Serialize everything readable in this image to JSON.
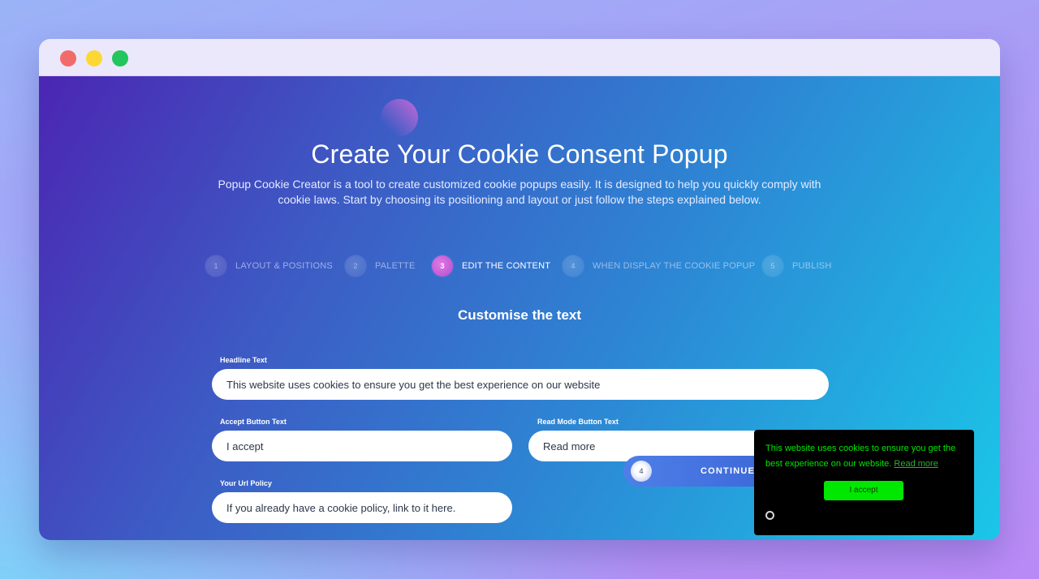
{
  "window": {
    "controls": [
      "close",
      "minimize",
      "maximize"
    ]
  },
  "hero": {
    "title": "Create Your Cookie Consent Popup",
    "subtitle": "Popup Cookie Creator is a tool to create customized cookie popups easily. It is designed to help you quickly comply with cookie laws. Start by choosing its positioning and layout or just follow the steps explained below."
  },
  "steps": [
    {
      "num": "1",
      "label": "LAYOUT & POSITIONS",
      "active": false
    },
    {
      "num": "2",
      "label": "PALETTE",
      "active": false
    },
    {
      "num": "3",
      "label": "EDIT THE CONTENT",
      "active": true
    },
    {
      "num": "4",
      "label": "WHEN DISPLAY THE COOKIE POPUP",
      "active": false
    },
    {
      "num": "5",
      "label": "PUBLISH",
      "active": false
    }
  ],
  "form": {
    "section_title": "Customise the text",
    "headline": {
      "label": "Headline Text",
      "value": "This website uses cookies to ensure you get the best experience on our website"
    },
    "accept": {
      "label": "Accept Button Text",
      "value": "I accept"
    },
    "read_more": {
      "label": "Read Mode Button Text",
      "value": "Read more"
    },
    "url_policy": {
      "label": "Your Url Policy",
      "placeholder": "If you already have a cookie policy, link to it here.",
      "value": ""
    },
    "continue": {
      "num": "4",
      "label": "CONTINUE"
    }
  },
  "cookie_preview": {
    "text": "This website uses cookies to ensure you get the best experience on our website.",
    "link_text": "Read more",
    "accept_label": "I accept",
    "colors": {
      "background": "#000000",
      "text": "#00e700",
      "button": "#00e700"
    },
    "icon": "cookie-settings-icon"
  }
}
